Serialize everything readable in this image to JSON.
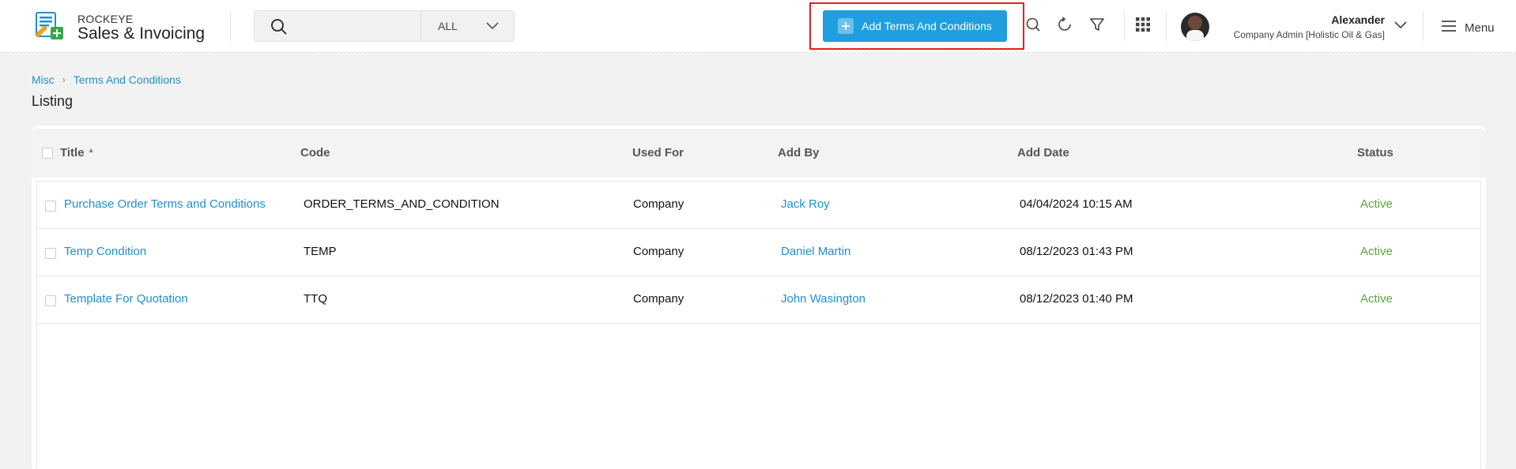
{
  "app": {
    "brand_small": "ROCKEYE",
    "brand_big": "Sales & Invoicing"
  },
  "search": {
    "placeholder": "",
    "scope": "ALL"
  },
  "toolbar": {
    "add_label": "Add Terms And Conditions"
  },
  "user": {
    "name": "Alexander",
    "role": "Company Admin [Holistic Oil & Gas]"
  },
  "menu": {
    "label": "Menu"
  },
  "breadcrumb": {
    "items": [
      "Misc",
      "Terms And Conditions"
    ]
  },
  "page": {
    "title": "Listing"
  },
  "table": {
    "columns": [
      "Title",
      "Code",
      "Used For",
      "Add By",
      "Add Date",
      "Status"
    ],
    "rows": [
      {
        "title": "Purchase Order Terms and Conditions",
        "code": "ORDER_TERMS_AND_CONDITION",
        "used_for": "Company",
        "add_by": "Jack Roy",
        "add_date": "04/04/2024 10:15 AM",
        "status": "Active"
      },
      {
        "title": "Temp Condition",
        "code": "TEMP",
        "used_for": "Company",
        "add_by": "Daniel Martin",
        "add_date": "08/12/2023 01:43 PM",
        "status": "Active"
      },
      {
        "title": "Template For Quotation",
        "code": "TTQ",
        "used_for": "Company",
        "add_by": "John Wasington",
        "add_date": "08/12/2023 01:40 PM",
        "status": "Active"
      }
    ]
  },
  "colors": {
    "accent": "#1f9fdf",
    "link": "#1f8fd0",
    "status_active": "#5aa63a",
    "highlight": "#e51e1e"
  }
}
